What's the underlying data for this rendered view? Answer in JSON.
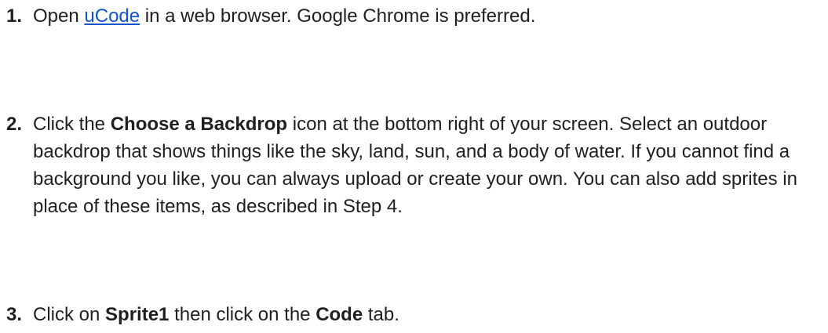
{
  "steps": [
    {
      "number": "1.",
      "parts": [
        {
          "text": "Open "
        },
        {
          "text": "uCode",
          "link": true
        },
        {
          "text": " in a web browser. Google Chrome is preferred."
        }
      ]
    },
    {
      "number": "2.",
      "parts": [
        {
          "text": "Click the "
        },
        {
          "text": "Choose a Backdrop",
          "bold": true
        },
        {
          "text": " icon at the bottom right of your screen. Select an outdoor backdrop that shows things like the sky, land, sun, and a body of water. If you cannot find a background you like, you can always upload or create your own. You can also add sprites in place of these items, as described in Step 4."
        }
      ]
    },
    {
      "number": "3.",
      "parts": [
        {
          "text": "Click on "
        },
        {
          "text": "Sprite1",
          "bold": true
        },
        {
          "text": " then click on the "
        },
        {
          "text": "Code",
          "bold": true
        },
        {
          "text": " tab."
        }
      ]
    }
  ]
}
